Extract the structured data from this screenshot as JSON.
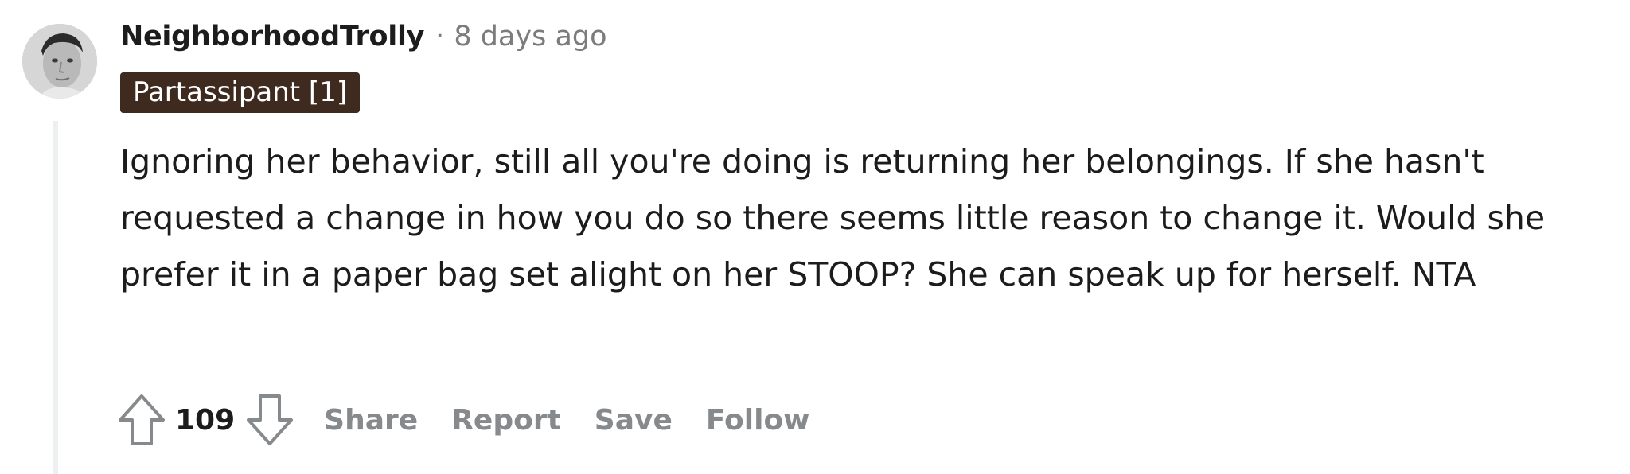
{
  "comment": {
    "username": "NeighborhoodTrolly",
    "separator": "·",
    "timestamp": "8 days ago",
    "flair": "Partassipant [1]",
    "body": "Ignoring her behavior, still all you're doing is returning her belongings. If she hasn't requested a change in how you do so there seems little reason to change it. Would she prefer it in a paper bag set alight on her STOOP? She can speak up for herself. NTA",
    "score": "109",
    "actions": {
      "share": "Share",
      "report": "Report",
      "save": "Save",
      "follow": "Follow"
    }
  },
  "icons": {
    "avatar": "user-avatar",
    "upvote": "arrow-up-icon",
    "downvote": "arrow-down-icon"
  },
  "colors": {
    "flair_bg": "#3f2a1f",
    "flair_text": "#ffffff",
    "muted": "#7c7c7c",
    "action_text": "#878a8c",
    "thread_line": "#edeff1"
  }
}
